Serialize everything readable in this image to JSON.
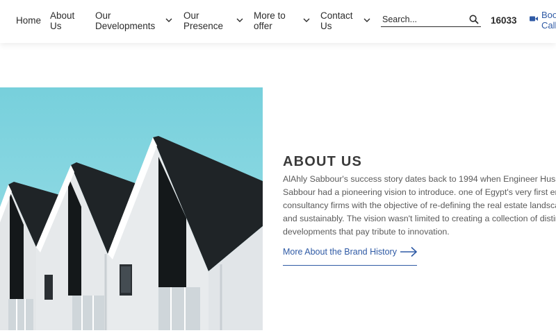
{
  "nav": {
    "home": "Home",
    "about": [
      "About",
      "Us"
    ],
    "developments": [
      "Our",
      "Developments"
    ],
    "presence": [
      "Our",
      "Presence"
    ],
    "offer": [
      "More to",
      "offer"
    ],
    "contact": [
      "Contact",
      "Us"
    ]
  },
  "search": {
    "placeholder": "Search..."
  },
  "phone": "16033",
  "book_call": [
    "Boo",
    "Call"
  ],
  "about": {
    "title": "ABOUT US",
    "lines": [
      "AlAhly Sabbour's success story dates back to 1994 when Engineer Huss",
      "Sabbour had a pioneering vision to introduce. one of Egypt's very first en",
      "consultancy firms with the objective of re-defining the real estate landsca",
      "and sustainably. The vision wasn't limited to creating a collection of distin",
      "developments that pay tribute to innovation."
    ],
    "link": "More About the Brand History"
  },
  "colors": {
    "accent": "#2f5aa5",
    "sky": "#7fd3dd",
    "roof": "#1f2427",
    "wall": "#e6e8ea"
  },
  "icons": {
    "search": "search-icon",
    "chevron": "chevron-down-icon",
    "video": "video-icon",
    "arrow": "arrow-right-icon"
  }
}
